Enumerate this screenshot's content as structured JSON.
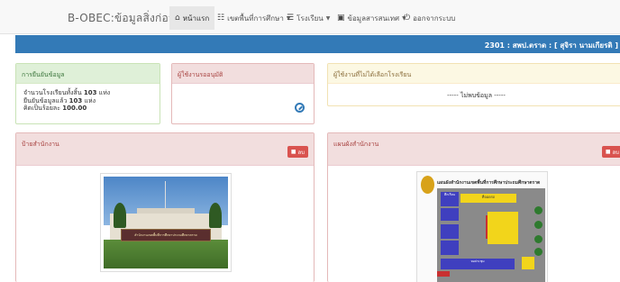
{
  "nav": {
    "brand": "B-OBEC:ข้อมูลสิ่งก่อสร้าง",
    "items": [
      {
        "label": "หน้าแรก",
        "icon": "home-icon",
        "caret": false
      },
      {
        "label": "เขตพื้นที่การศึกษา",
        "icon": "grid-icon",
        "caret": true
      },
      {
        "label": "โรงเรียน",
        "icon": "list-icon",
        "caret": true
      },
      {
        "label": "ข้อมูลสารสนเทศ",
        "icon": "book-icon",
        "caret": true
      },
      {
        "label": "ออกจากระบบ",
        "icon": "power-icon",
        "caret": false
      }
    ]
  },
  "header_bar": {
    "user": "2301 : สพป.ตราด :  [ สุจิรา นามเกียรติ ]"
  },
  "panels": {
    "confirm": {
      "title": "การยืนยันข้อมูล",
      "line1_prefix": "จำนวนโรงเรียนทั้งสิ้น ",
      "line1_value": "103",
      "line1_suffix": " แห่ง",
      "line2_prefix": "ยืนยันข้อมูลแล้ว ",
      "line2_value": "103",
      "line2_suffix": " แห่ง",
      "line3_prefix": "คิดเป็นร้อยละ ",
      "line3_value": "100.00"
    },
    "pending_users": {
      "title": "ผู้ใช้งานรออนุมัติ"
    },
    "no_school_users": {
      "title": "ผู้ใช้งานที่ไม่ได้เลือกโรงเรียน",
      "empty": "----- ไม่พบข้อมูล -----"
    },
    "office_sign": {
      "title": "ป้ายสำนักงาน",
      "delete_label": "ลบ",
      "photo_sign_text": "สำนักงานเขตพื้นที่การศึกษาประถมศึกษาตราด"
    },
    "office_map": {
      "title": "แผนผังสำนักงาน",
      "delete_label": "ลบ",
      "map_title": "แผนผังสำนักงานเขตพื้นที่การศึกษาประถมศึกษาตราด",
      "labels": {
        "a": "ตึกเรียน",
        "b": "ที่จอดรถ",
        "c": "หอประชุม"
      }
    }
  },
  "colors": {
    "accent": "#337ab7",
    "danger": "#d9534f"
  }
}
